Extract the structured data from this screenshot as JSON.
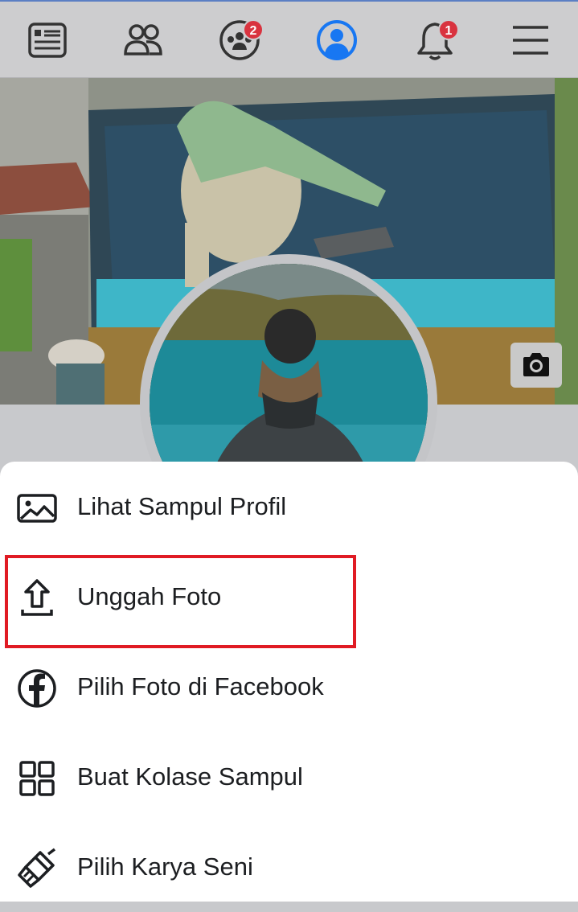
{
  "nav": {
    "items": [
      {
        "icon": "news-feed-icon"
      },
      {
        "icon": "friends-icon"
      },
      {
        "icon": "groups-icon",
        "badge": "2"
      },
      {
        "icon": "profile-icon",
        "active": true
      },
      {
        "icon": "notifications-icon",
        "badge": "1"
      },
      {
        "icon": "menu-icon"
      }
    ],
    "active_color": "#1877f2",
    "badge_color": "#d9333f"
  },
  "cover": {
    "camera_icon": "camera-icon"
  },
  "sheet": {
    "items": [
      {
        "label": "Lihat Sampul Profil",
        "icon": "image-icon"
      },
      {
        "label": "Unggah Foto",
        "icon": "upload-icon"
      },
      {
        "label": "Pilih Foto di Facebook",
        "icon": "facebook-icon"
      },
      {
        "label": "Buat Kolase Sampul",
        "icon": "grid-icon"
      },
      {
        "label": "Pilih Karya Seni",
        "icon": "paintbrush-icon"
      }
    ],
    "highlight_color": "#e01b24"
  }
}
